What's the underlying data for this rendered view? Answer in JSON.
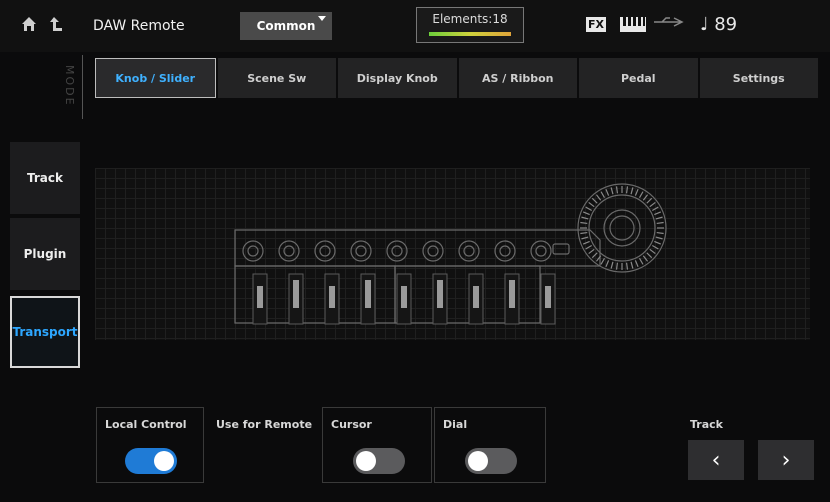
{
  "header": {
    "title": "DAW Remote",
    "common_label": "Common",
    "elements_label": "Elements:18",
    "fx_label": "FX",
    "tempo": "♩ 89"
  },
  "mode": {
    "label": "MODE"
  },
  "tabs": [
    {
      "label": "Knob / Slider",
      "active": true
    },
    {
      "label": "Scene Sw"
    },
    {
      "label": "Display Knob"
    },
    {
      "label": "AS / Ribbon"
    },
    {
      "label": "Pedal"
    },
    {
      "label": "Settings"
    }
  ],
  "sidebar": [
    {
      "label": "Track"
    },
    {
      "label": "Plugin"
    },
    {
      "label": "Transport",
      "active": true
    }
  ],
  "controls": {
    "local_control": {
      "label": "Local Control",
      "state": "on"
    },
    "use_for_remote_label": "Use for Remote",
    "cursor": {
      "label": "Cursor",
      "state": "off"
    },
    "dial": {
      "label": "Dial",
      "state": "off"
    },
    "track": {
      "label": "Track"
    }
  },
  "colors": {
    "accent_blue": "#3fb1ff",
    "toggle_on": "#1f7bd6",
    "toggle_off": "#5b5b5d"
  },
  "icons": [
    "home-icon",
    "back-icon",
    "usb-icon",
    "keyboard-icon",
    "chevron-left-icon",
    "chevron-right-icon"
  ]
}
